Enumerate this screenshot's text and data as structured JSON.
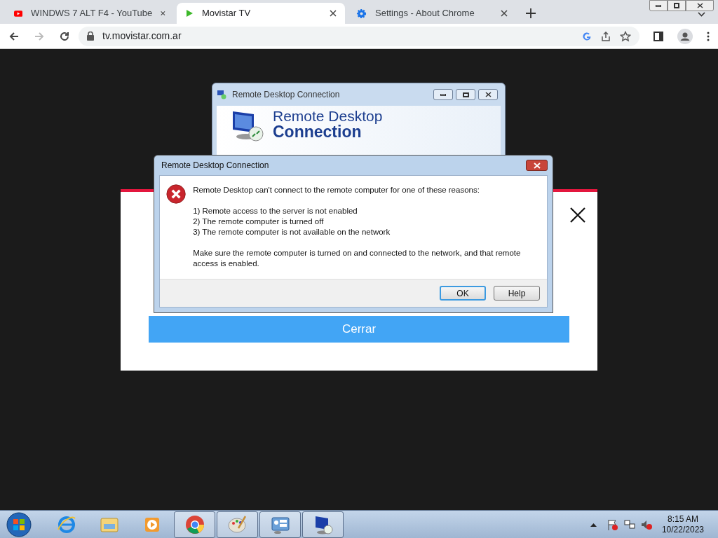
{
  "browser": {
    "tabs": [
      {
        "title": "WINDWS 7 ALT F4 - YouTube",
        "kind": "youtube",
        "selected": false
      },
      {
        "title": "Movistar TV",
        "kind": "play",
        "selected": true
      },
      {
        "title": "Settings - About Chrome",
        "kind": "gear",
        "selected": false
      }
    ],
    "address": "tv.movistar.com.ar"
  },
  "page": {
    "modal_button": "Cerrar"
  },
  "rdc_window": {
    "title": "Remote Desktop Connection",
    "heading_line1": "Remote Desktop",
    "heading_line2": "Connection"
  },
  "error_dialog": {
    "title": "Remote Desktop Connection",
    "message": "Remote Desktop can't connect to the remote computer for one of these reasons:",
    "reasons": [
      "1) Remote access to the server is not enabled",
      "2) The remote computer is turned off",
      "3) The remote computer is not available on the network"
    ],
    "advice": "Make sure the remote computer is turned on and connected to the network, and that remote access is enabled.",
    "buttons": [
      {
        "label": "OK",
        "default": true
      },
      {
        "label": "Help",
        "default": false
      }
    ]
  },
  "taskbar": {
    "items": [
      {
        "kind": "ie",
        "running": false
      },
      {
        "kind": "explorer",
        "running": false
      },
      {
        "kind": "media",
        "running": false
      },
      {
        "kind": "chrome",
        "running": true
      },
      {
        "kind": "paint",
        "running": true
      },
      {
        "kind": "panel",
        "running": true
      },
      {
        "kind": "rdc",
        "running": true
      }
    ],
    "time": "8:15 AM",
    "date": "10/22/2023"
  }
}
